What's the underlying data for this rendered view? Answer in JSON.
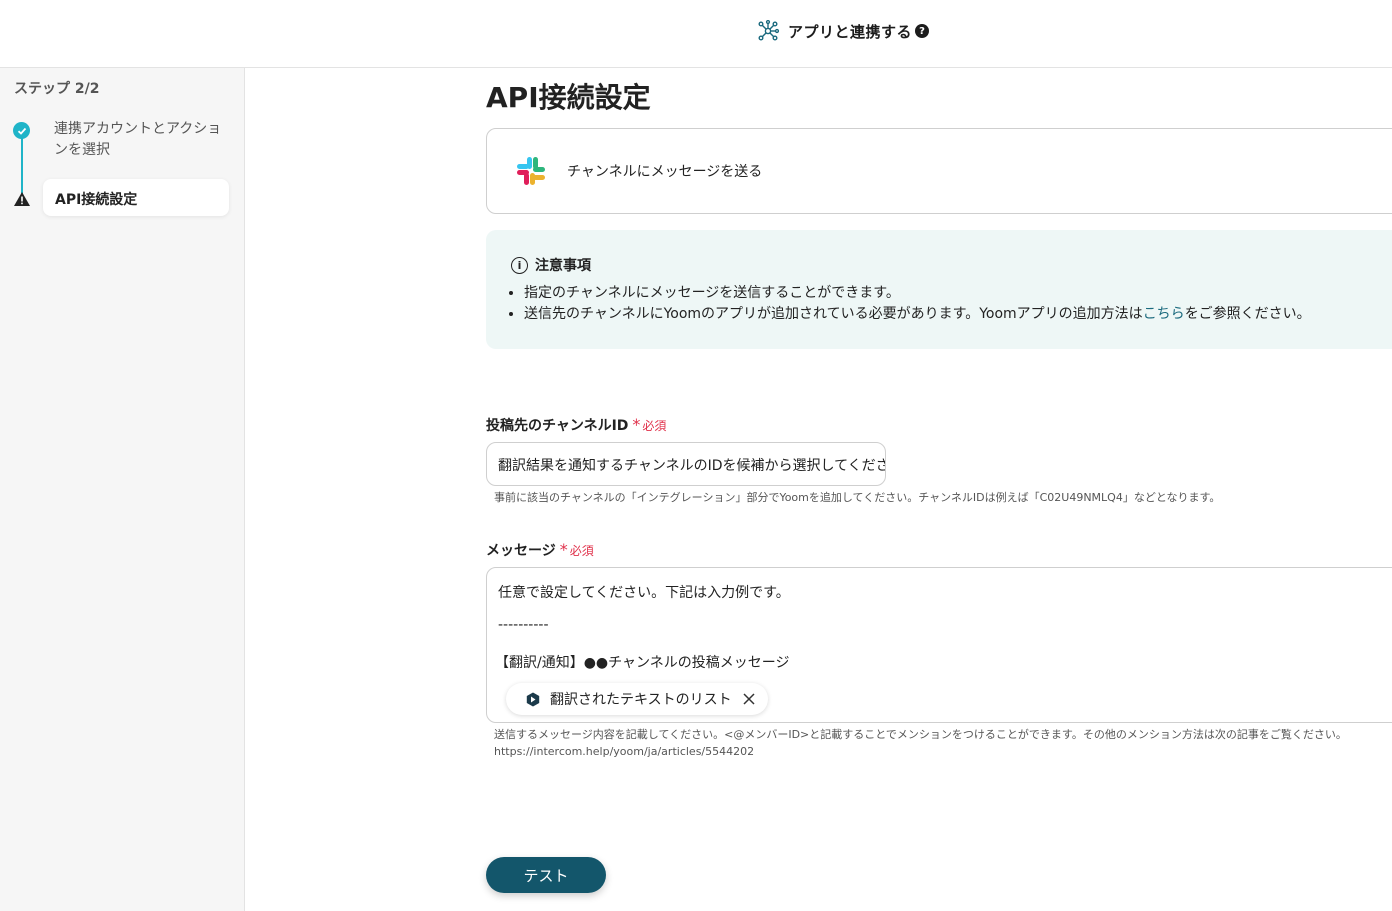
{
  "header": {
    "title": "アプリと連携する",
    "help_icon": "question-circle-icon",
    "help_glyph": "?"
  },
  "sidebar": {
    "step_count": "ステップ 2/2",
    "steps": [
      {
        "label": "連携アカウントとアクションを選択",
        "status": "completed"
      },
      {
        "label": "API接続設定",
        "status": "current-warning"
      }
    ]
  },
  "main": {
    "title": "API接続設定",
    "action": {
      "app_icon": "slack-icon",
      "label": "チャンネルにメッセージを送る"
    },
    "notice": {
      "title": "注意事項",
      "items": [
        "指定のチャンネルにメッセージを送信することができます。",
        "送信先のチャンネルにYoomのアプリが追加されている必要があります。Yoomアプリの追加方法は"
      ],
      "link_text": "こちら",
      "item2_suffix": "をご参照ください。"
    },
    "channel_field": {
      "label": "投稿先のチャンネルID",
      "required": "必須",
      "value": "翻訳結果を通知するチャンネルのIDを候補から選択してください",
      "hint": "事前に該当のチャンネルの「インテグレーション」部分でYoomを追加してください。チャンネルIDは例えば「C02U49NMLQ4」などとなります。"
    },
    "message_field": {
      "label": "メッセージ",
      "required": "必須",
      "lines": [
        "任意で設定してください。下記は入力例です。",
        "----------",
        "【翻訳/通知】●●チャンネルの投稿メッセージ"
      ],
      "chip_label": "翻訳されたテキストのリスト",
      "hint_line1": "送信するメッセージ内容を記載してください。<@メンバーID>と記載することでメンションをつけることができます。その他のメンション方法は次の記事をご覧ください。",
      "hint_line2": "https://intercom.help/yoom/ja/articles/5544202"
    },
    "test_button": "テスト"
  },
  "colors": {
    "accent": "#1fb4c8",
    "primary_button": "#13566b",
    "required": "#e0314b",
    "notice_bg": "#eef7f6",
    "link": "#1b6a7e"
  }
}
